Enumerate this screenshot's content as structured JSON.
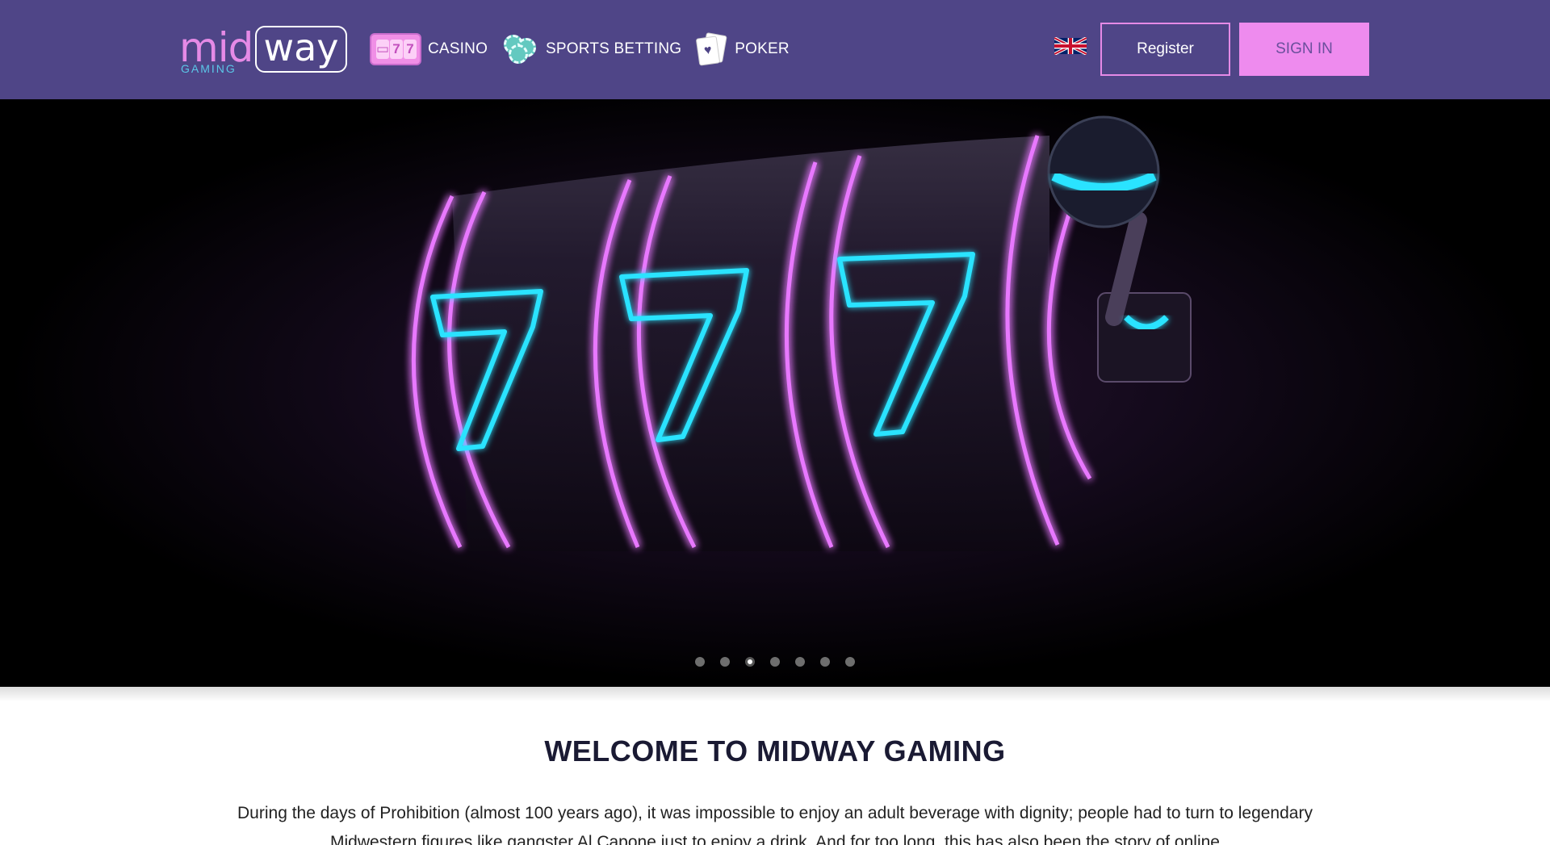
{
  "header": {
    "logo": {
      "mid": "mid",
      "way": "way",
      "gaming": "GAMING"
    },
    "nav": [
      {
        "label": "CASINO",
        "icon": "slot-machine-icon"
      },
      {
        "label": "SPORTS BETTING",
        "icon": "chips-icon"
      },
      {
        "label": "POKER",
        "icon": "cards-icon"
      }
    ],
    "language_flag": "uk-flag-icon",
    "register_label": "Register",
    "signin_label": "SIGN IN"
  },
  "hero": {
    "slide_count": 7,
    "active_slide": 3,
    "reel_symbols": [
      "7",
      "7",
      "7"
    ]
  },
  "main": {
    "title": "WELCOME TO MIDWAY GAMING",
    "intro": "During the days of Prohibition (almost 100 years ago), it was impossible to enjoy an adult beverage with dignity; people had to turn to legendary Midwestern figures like gangster Al Capone just to enjoy a drink. And for too long, this has also been the story of online"
  },
  "colors": {
    "header_bg": "#4f4587",
    "accent_pink": "#ee8bee",
    "neon_cyan": "#29e3ff",
    "neon_magenta": "#e455ff"
  }
}
